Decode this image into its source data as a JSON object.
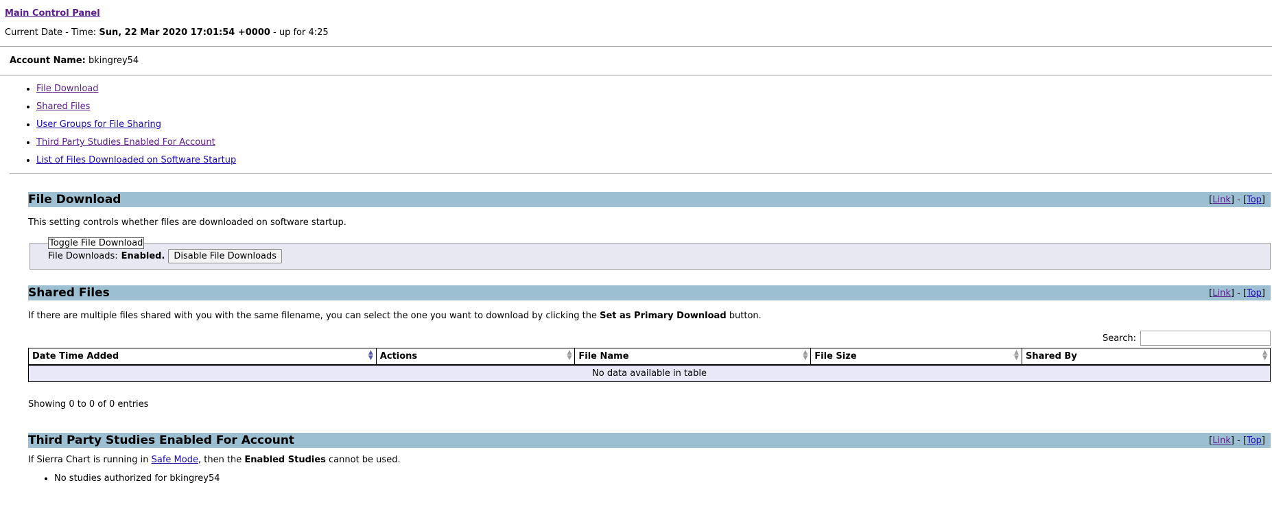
{
  "header": {
    "title": "Main Control Panel",
    "date_label": "Current Date - Time:",
    "date_value": "Sun, 22 Mar 2020 17:01:54 +0000",
    "uptime": " - up for 4:25"
  },
  "account": {
    "label": "Account Name:",
    "value": "bkingrey54"
  },
  "nav": [
    "File Download",
    "Shared Files",
    "User Groups for File Sharing",
    "Third Party Studies Enabled For Account",
    "List of Files Downloaded on Software Startup"
  ],
  "section_links": {
    "link": "Link",
    "top": "Top"
  },
  "file_download": {
    "title": "File Download",
    "desc": "This setting controls whether files are downloaded on software startup.",
    "legend": "Toggle File Download",
    "status_label": "File Downloads:",
    "status_value": "Enabled.",
    "button": "Disable File Downloads"
  },
  "shared_files": {
    "title": "Shared Files",
    "desc_before": "If there are multiple files shared with you with the same filename, you can select the one you want to download by clicking the ",
    "desc_bold": "Set as Primary Download",
    "desc_after": " button.",
    "search_label": "Search:",
    "search_value": "",
    "columns": [
      "Date Time Added",
      "Actions",
      "File Name",
      "File Size",
      "Shared By"
    ],
    "empty": "No data available in table",
    "showing": "Showing 0 to 0 of 0 entries"
  },
  "third_party": {
    "title": "Third Party Studies Enabled For Account",
    "desc_before": "If Sierra Chart is running in ",
    "desc_link": "Safe Mode",
    "desc_mid": ", then the ",
    "desc_bold": "Enabled Studies",
    "desc_after": " cannot be used.",
    "item": "No studies authorized for bkingrey54"
  }
}
